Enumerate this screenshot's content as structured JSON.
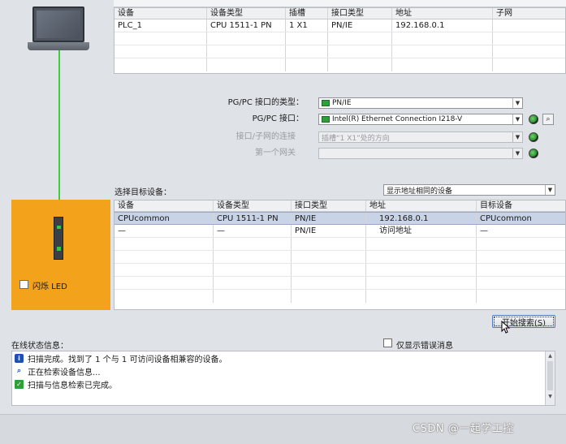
{
  "top_table": {
    "columns": [
      "设备",
      "设备类型",
      "插槽",
      "接口类型",
      "地址",
      "子网"
    ],
    "rows": [
      [
        "PLC_1",
        "CPU 1511-1 PN",
        "1 X1",
        "PN/IE",
        "192.168.0.1",
        ""
      ]
    ]
  },
  "form": {
    "interface_type_label": "PG/PC 接口的类型：",
    "interface_type_value": "PN/IE",
    "interface_label": "PG/PC 接口：",
    "interface_value": "Intel(R) Ethernet Connection I218-V",
    "subnet_conn_label": "接口/子网的连接",
    "subnet_conn_value": "插槽“1 X1”处的方向",
    "gateway_label": "第一个网关",
    "gateway_value": ""
  },
  "target": {
    "label": "选择目标设备：",
    "filter_value": "显示地址相同的设备",
    "columns": [
      "设备",
      "设备类型",
      "接口类型",
      "地址",
      "目标设备"
    ],
    "rows": [
      [
        "CPUcommon",
        "CPU 1511-1 PN",
        "PN/IE",
        "192.168.0.1",
        "CPUcommon"
      ],
      [
        "—",
        "—",
        "PN/IE",
        "访问地址",
        "—"
      ]
    ]
  },
  "flash_led_label": "闪烁 LED",
  "start_search_button": "开始搜索(S)",
  "online_status": {
    "label": "在线状态信息：",
    "errors_only_label": "仅显示错误消息",
    "messages": [
      {
        "icon": "info-icon",
        "text": "扫描完成。找到了 1 个与 1 可访问设备相兼容的设备。"
      },
      {
        "icon": "search-progress-icon",
        "text": "正在检索设备信息..."
      },
      {
        "icon": "check-icon",
        "text": "扫描与信息检索已完成。"
      }
    ]
  },
  "watermark": "CSDN @一起学工控"
}
